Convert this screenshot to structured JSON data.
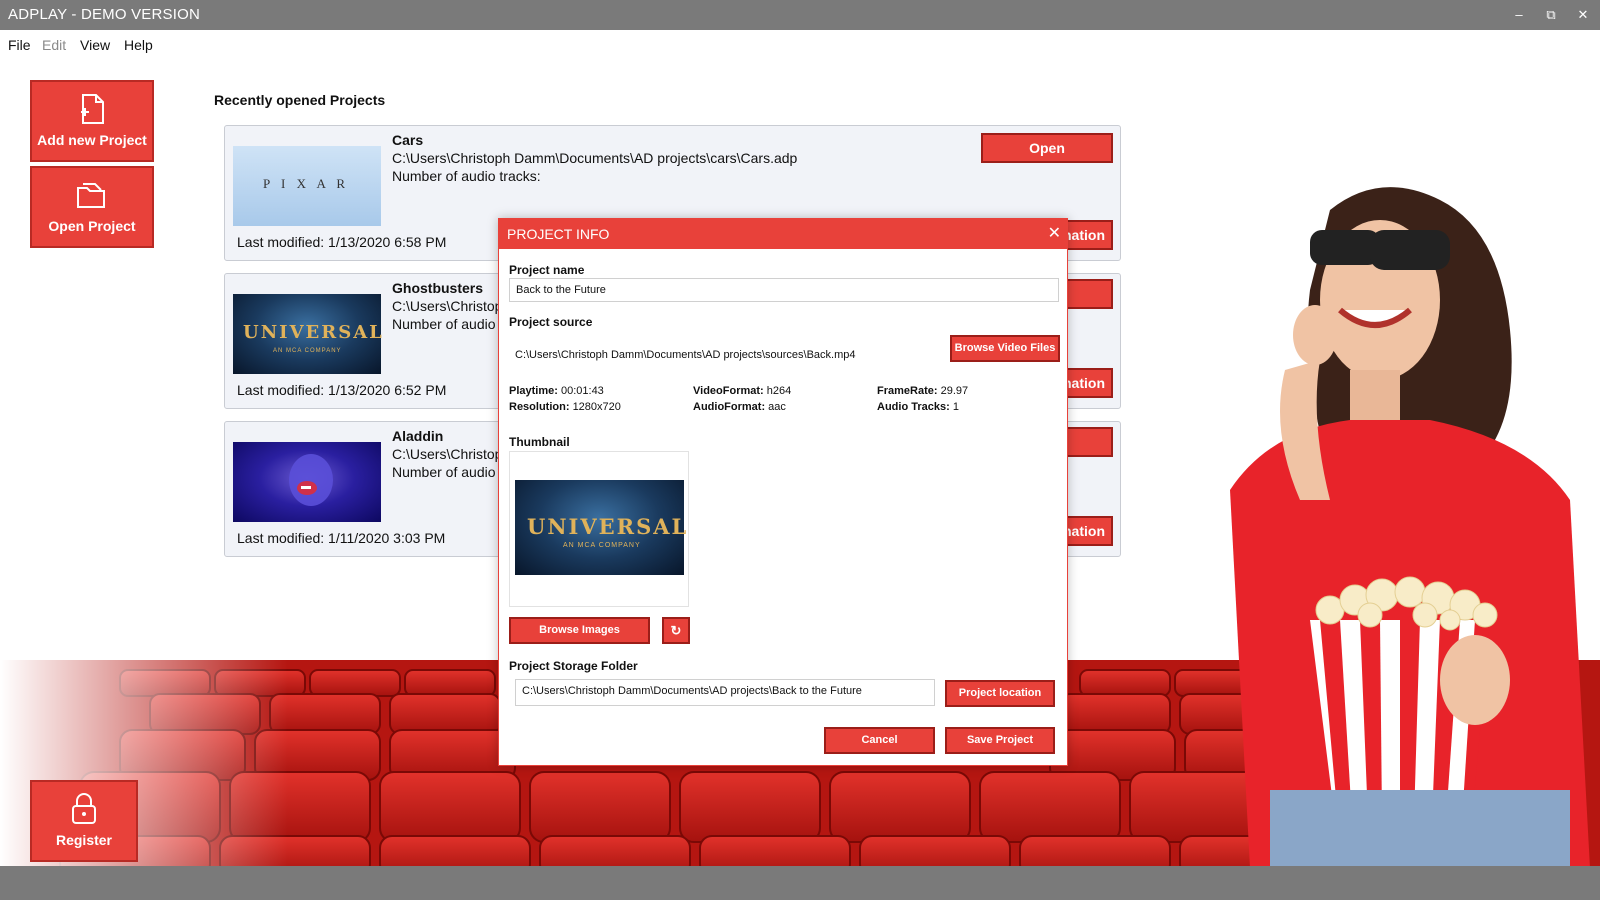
{
  "window": {
    "title": "ADPLAY - DEMO VERSION",
    "controls": {
      "minimize": "–",
      "restore": "⧉",
      "close": "✕"
    }
  },
  "menu": [
    "File",
    "Edit",
    "View",
    "Help"
  ],
  "sidebar": {
    "add_project": "Add new Project",
    "open_project": "Open Project",
    "register": "Register"
  },
  "recent": {
    "heading": "Recently opened Projects",
    "projects": [
      {
        "name": "Cars",
        "path": "C:\\Users\\Christoph Damm\\Documents\\AD projects\\cars\\Cars.adp",
        "tracks_label": "Number of audio tracks:",
        "modified": "Last modified: 1/13/2020 6:58 PM",
        "thumb": "PIXAR"
      },
      {
        "name": "Ghostbusters",
        "path": "C:\\Users\\Christop",
        "tracks_label": "Number of audio",
        "modified": "Last modified: 1/13/2020 6:52 PM",
        "thumb": "UNIVERSAL"
      },
      {
        "name": "Aladdin",
        "path": "C:\\Users\\Christop",
        "tracks_label": "Number of audio",
        "modified": "Last modified: 1/11/2020 3:03 PM",
        "thumb": "Aladdin"
      }
    ],
    "open_label": "Open",
    "right_btn_label": "nation"
  },
  "dialog": {
    "title": "PROJECT INFO",
    "close": "✕",
    "project_name_label": "Project name",
    "project_name_value": "Back to the Future",
    "project_source_label": "Project source",
    "project_source_value": "C:\\Users\\Christoph Damm\\Documents\\AD projects\\sources\\Back.mp4",
    "browse_video": "Browse Video Files",
    "playtime_label": "Playtime:",
    "playtime_value": "00:01:43",
    "resolution_label": "Resolution:",
    "resolution_value": "1280x720",
    "videoformat_label": "VideoFormat:",
    "videoformat_value": "h264",
    "audioformat_label": "AudioFormat:",
    "audioformat_value": "aac",
    "framerate_label": "FrameRate:",
    "framerate_value": "29.97",
    "audiotracks_label": "Audio Tracks:",
    "audiotracks_value": "1",
    "thumbnail_label": "Thumbnail",
    "thumbnail_text": "UNIVERSAL",
    "thumbnail_sub": "AN MCA COMPANY",
    "browse_images": "Browse Images",
    "refresh_icon": "↻",
    "storage_label": "Project Storage Folder",
    "storage_value": "C:\\Users\\Christoph Damm\\Documents\\AD projects\\Back to the Future",
    "project_location": "Project location",
    "cancel": "Cancel",
    "save": "Save Project"
  },
  "logo_texts": {
    "pixar": "P I X A R",
    "universal": "UNIVERSAL",
    "universal_sub": "AN MCA COMPANY"
  },
  "colors": {
    "accent": "#e8413a",
    "titlebar": "#7a7a7a",
    "card_bg": "#f1f3f8"
  }
}
